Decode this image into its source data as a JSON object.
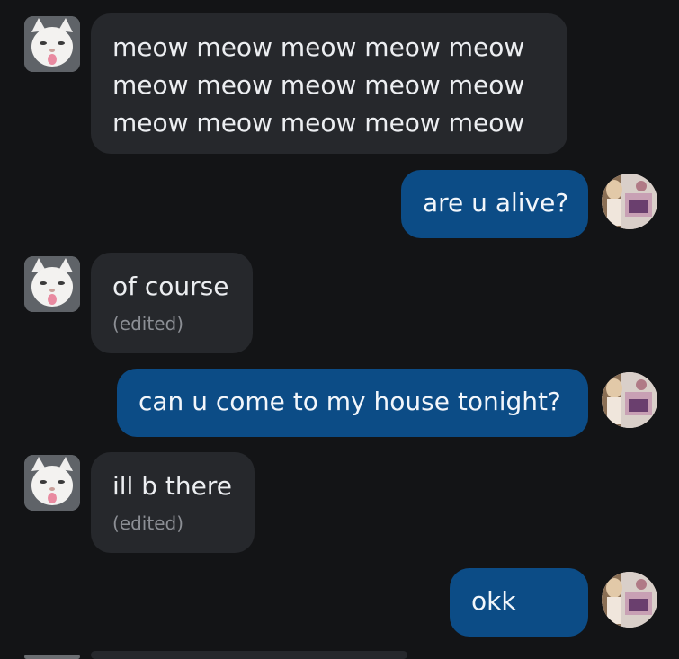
{
  "messages": [
    {
      "id": "m1",
      "sender": "cat",
      "text_lines": [
        "meow meow meow meow meow",
        "meow meow meow meow meow",
        "meow meow meow meow meow"
      ],
      "edited": ""
    },
    {
      "id": "m2",
      "sender": "user",
      "text": "are u alive?"
    },
    {
      "id": "m3",
      "sender": "cat",
      "text": "of course",
      "edited": "(edited)"
    },
    {
      "id": "m4",
      "sender": "user",
      "text": "can u come to my house tonight?"
    },
    {
      "id": "m5",
      "sender": "cat",
      "text": "ill b there",
      "edited": "(edited)"
    },
    {
      "id": "m6",
      "sender": "user",
      "text": "okk"
    }
  ],
  "colors": {
    "background": "#131416",
    "incoming_bubble": "#26282c",
    "outgoing_bubble": "#0c4c86",
    "edited_text": "#8c8f95"
  },
  "icons": {
    "cat_avatar": "cat-avatar-icon",
    "user_avatar": "user-avatar-icon"
  }
}
